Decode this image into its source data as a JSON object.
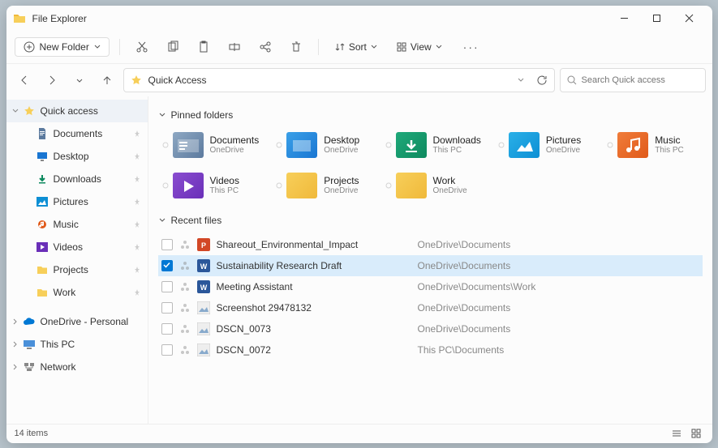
{
  "window": {
    "title": "File Explorer"
  },
  "toolbar": {
    "new_label": "New Folder",
    "sort_label": "Sort",
    "view_label": "View"
  },
  "address": {
    "path": "Quick Access",
    "search_placeholder": "Search Quick access"
  },
  "sidebar": {
    "quick_access": "Quick access",
    "items": [
      {
        "label": "Documents",
        "icon": "document"
      },
      {
        "label": "Desktop",
        "icon": "desktop"
      },
      {
        "label": "Downloads",
        "icon": "download"
      },
      {
        "label": "Pictures",
        "icon": "picture"
      },
      {
        "label": "Music",
        "icon": "music"
      },
      {
        "label": "Videos",
        "icon": "video"
      },
      {
        "label": "Projects",
        "icon": "folder"
      },
      {
        "label": "Work",
        "icon": "folder"
      }
    ],
    "onedrive": "OneDrive - Personal",
    "this_pc": "This PC",
    "network": "Network"
  },
  "sections": {
    "pinned": "Pinned folders",
    "recent": "Recent files"
  },
  "pinned_folders": [
    {
      "name": "Documents",
      "sub": "OneDrive",
      "color": "docs"
    },
    {
      "name": "Desktop",
      "sub": "OneDrive",
      "color": "desk"
    },
    {
      "name": "Downloads",
      "sub": "This PC",
      "color": "down"
    },
    {
      "name": "Pictures",
      "sub": "OneDrive",
      "color": "pics"
    },
    {
      "name": "Music",
      "sub": "This PC",
      "color": "music"
    },
    {
      "name": "Videos",
      "sub": "This PC",
      "color": "vids"
    },
    {
      "name": "Projects",
      "sub": "OneDrive",
      "color": "proj"
    },
    {
      "name": "Work",
      "sub": "OneDrive",
      "color": "work"
    }
  ],
  "recent_files": [
    {
      "name": "Shareout_Environmental_Impact",
      "loc": "OneDrive\\Documents",
      "type": "ppt",
      "selected": false
    },
    {
      "name": "Sustainability Research Draft",
      "loc": "OneDrive\\Documents",
      "type": "doc",
      "selected": true
    },
    {
      "name": "Meeting Assistant",
      "loc": "OneDrive\\Documents\\Work",
      "type": "doc",
      "selected": false
    },
    {
      "name": "Screenshot 29478132",
      "loc": "OneDrive\\Documents",
      "type": "image",
      "selected": false
    },
    {
      "name": "DSCN_0073",
      "loc": "OneDrive\\Documents",
      "type": "image",
      "selected": false
    },
    {
      "name": "DSCN_0072",
      "loc": "This PC\\Documents",
      "type": "image",
      "selected": false
    }
  ],
  "status": {
    "item_count": "14 items"
  }
}
